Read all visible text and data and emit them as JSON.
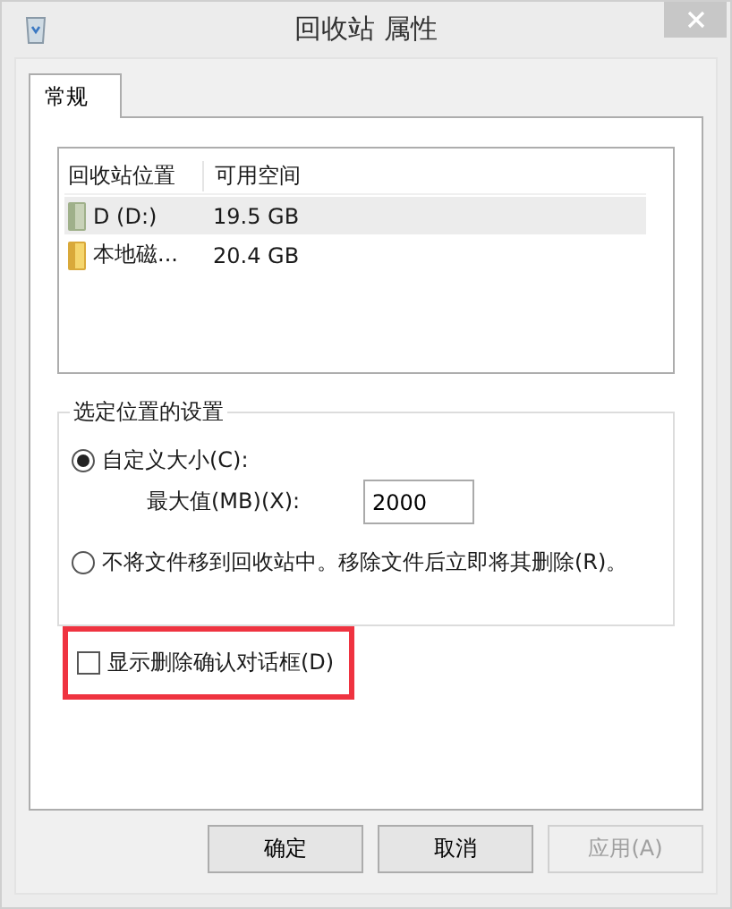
{
  "window": {
    "title": "回收站 属性"
  },
  "tabs": [
    {
      "label": "常规",
      "selected": true
    }
  ],
  "locations": {
    "columns": [
      "回收站位置",
      "可用空间"
    ],
    "rows": [
      {
        "name": "D (D:)",
        "free": "19.5 GB",
        "selected": true,
        "kind": "drive"
      },
      {
        "name": "本地磁...",
        "free": "20.4 GB",
        "selected": false,
        "kind": "folder"
      }
    ]
  },
  "settings": {
    "title": "选定位置的设置",
    "options": [
      {
        "kind": "radio",
        "label": "自定义大小(C):",
        "selected": true,
        "field": {
          "label": "最大值(MB)(X):",
          "value": "2000"
        }
      },
      {
        "kind": "radio",
        "label": "不将文件移到回收站中。移除文件后立即将其删除(R)。",
        "selected": false
      }
    ]
  },
  "confirm": {
    "label": "显示删除确认对话框(D)",
    "checked": false,
    "highlighted": true
  },
  "buttons": [
    {
      "label": "确定",
      "disabled": false
    },
    {
      "label": "取消",
      "disabled": false
    },
    {
      "label": "应用(A)",
      "disabled": true
    }
  ]
}
